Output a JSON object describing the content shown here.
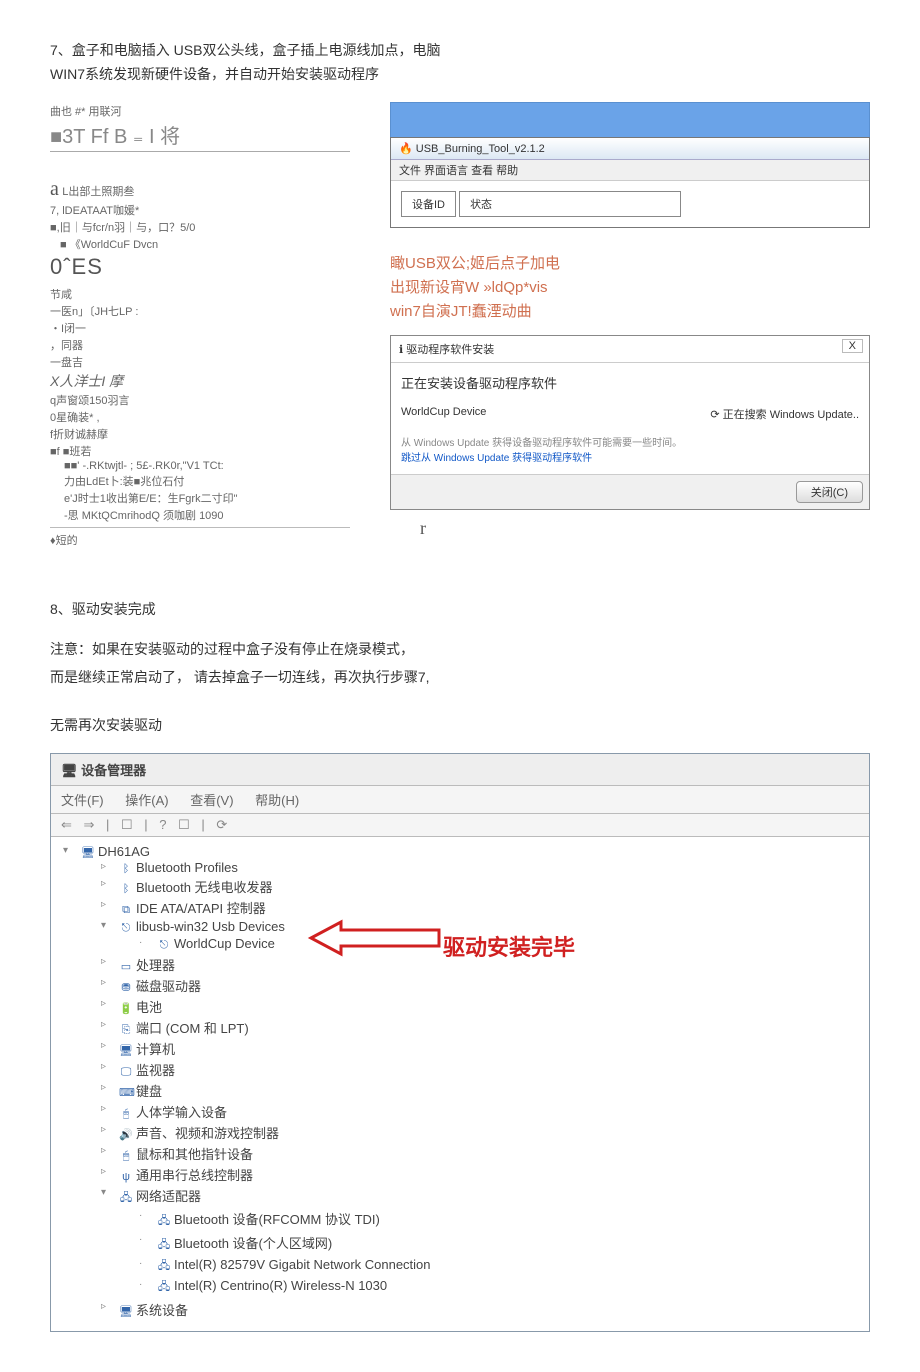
{
  "step7": {
    "heading_l1": "7、盒子和电脑插入 USB双公头线，盒子插上电源线加点，电脑",
    "heading_l2": "WIN7系统发现新硬件设备，并自动开始安装驱动程序"
  },
  "garbled_left": {
    "l1": "曲也        #* 用联河",
    "l2": "■3T Ff B ₌ I 将",
    "a_label": "a",
    "a_text": "L出部土照期叁",
    "l3": "7, lDEATAAT咖媛*",
    "l4": "■,旧｜与fcr/n羽｜与，口？5/0",
    "l5": "■ 《WorldCuF Dvcn",
    "oes": "0ˆES",
    "l6": "节咸",
    "l7": "一医n」〔JH七LP :",
    "l8": "・I闭一",
    "l9": "，同器",
    "l10": "一盘吉",
    "l11": "X人洋士I 摩",
    "l12": "q声窗颂150羽言",
    "l13": "0星确装* ,",
    "l14": "f折财诚赫摩",
    "l15": "■f ■班若",
    "l16": "■■' -.RKtwjtl- ; 5£-.RK0r,\"V1 TCt:",
    "l17": "力由LdEt卜:装■兆位石付",
    "l18": "e'J时士1收出第E/E：生Fgrk二寸印\"",
    "l19": "-思 MKtQCmrihodQ 须咖剧 1090",
    "l20": "♦短的"
  },
  "burning_tool": {
    "title": "USB_Burning_Tool_v2.1.2",
    "menu": "文件  界面语言  查看  帮助",
    "col1": "设备ID",
    "col2": "状态"
  },
  "red_lines": {
    "r1": "瞰USB双公;姬后点子加电",
    "r2": "出现新设宵W »ldQp*vis",
    "r3": "win7自演JT!蠢湮动曲"
  },
  "driver_dialog": {
    "title": "驱动程序软件安装",
    "close_x": "X",
    "main": "正在安装设备驱动程序软件",
    "device": "WorldCup Device",
    "status": "⟳ 正在搜索 Windows Update..",
    "note": "从 Windows Update 获得设备驱动程序软件可能需要一些时间。",
    "link": "跳过从 Windows Update 获得驱动程序软件",
    "close_btn": "关闭(C)"
  },
  "r_mark": "r",
  "step8": {
    "heading": "8、驱动安装完成",
    "p1": "注意：如果在安装驱动的过程中盒子没有停止在烧录模式，",
    "p2": "而是继续正常启动了，  请去掉盒子一切连线，再次执行步骤7,",
    "p3": "无需再次安装驱动"
  },
  "devmgr": {
    "title": "设备管理器",
    "menu_file": "文件(F)",
    "menu_action": "操作(A)",
    "menu_view": "查看(V)",
    "menu_help": "帮助(H)",
    "toolbar": "⇐ ⇒ | ☐ | ? ☐ | ⟳",
    "root": "DH61AG",
    "items": {
      "bt_profiles": "Bluetooth Profiles",
      "bt_radio": "Bluetooth 无线电收发器",
      "ide": "IDE ATA/ATAPI 控制器",
      "libusb": "libusb-win32 Usb Devices",
      "worldcup": "WorldCup Device",
      "cpu": "处理器",
      "disk": "磁盘驱动器",
      "battery": "电池",
      "ports": "端口 (COM 和 LPT)",
      "computer": "计算机",
      "monitor": "监视器",
      "keyboard": "键盘",
      "hid": "人体学输入设备",
      "sound": "声音、视频和游戏控制器",
      "mouse": "鼠标和其他指针设备",
      "usb": "通用串行总线控制器",
      "network": "网络适配器",
      "net1": "Bluetooth 设备(RFCOMM 协议 TDI)",
      "net2": "Bluetooth 设备(个人区域网)",
      "net3": "Intel(R) 82579V Gigabit Network Connection",
      "net4": "Intel(R) Centrino(R) Wireless-N 1030",
      "system": "系统设备"
    },
    "arrow_label": "驱动安装完毕"
  }
}
